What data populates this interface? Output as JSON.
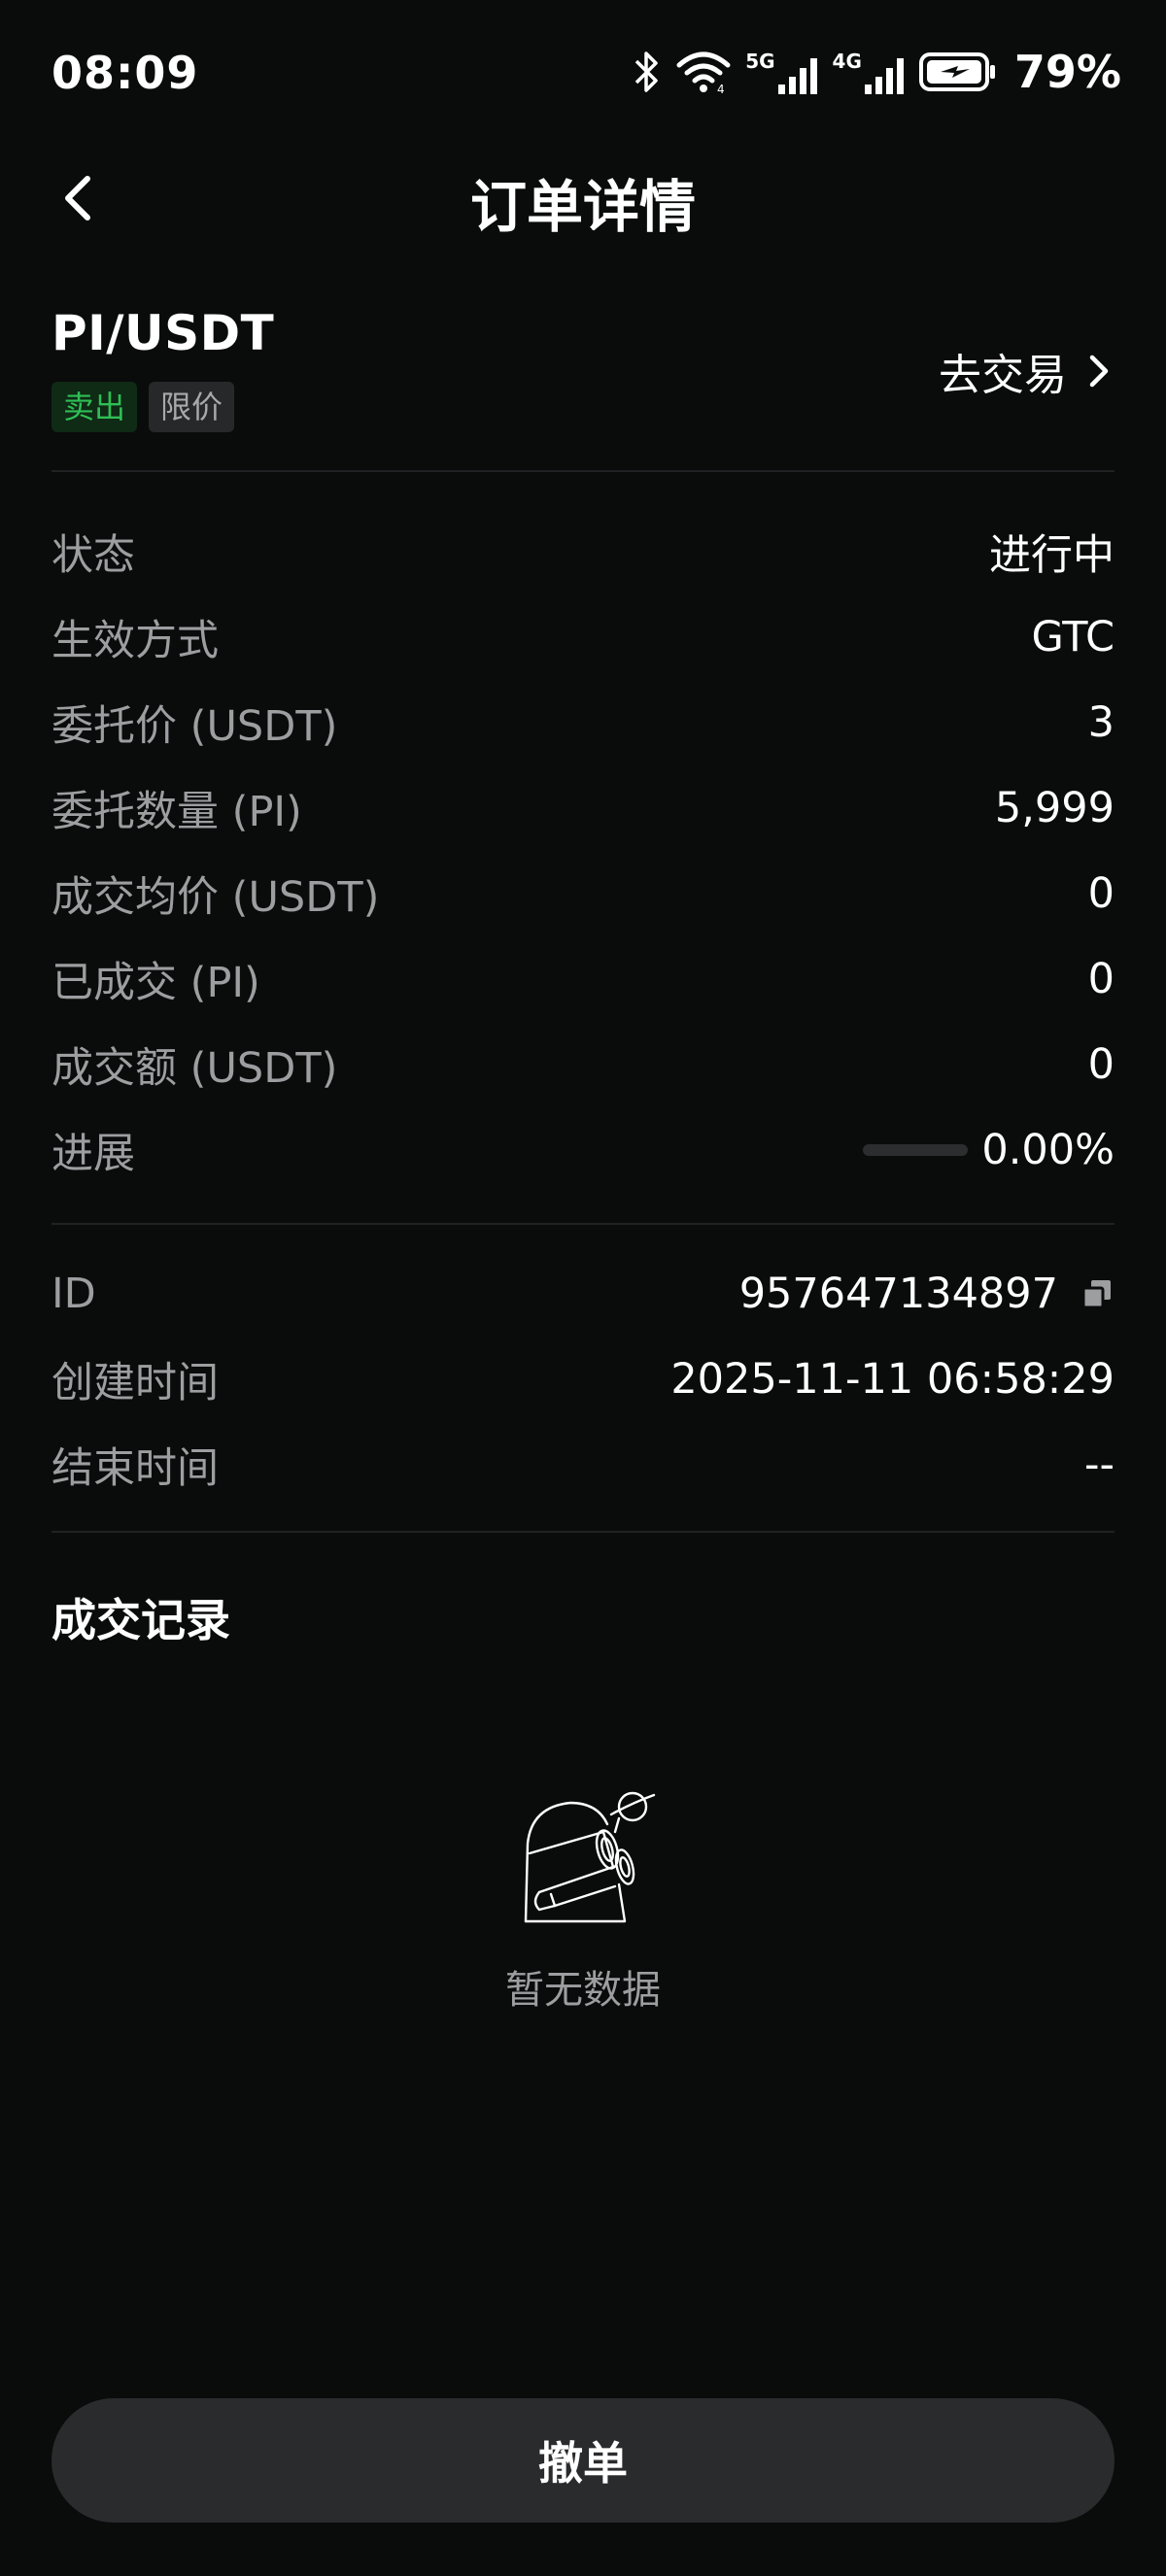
{
  "status_bar": {
    "time": "08:09",
    "battery": "79%",
    "icons": [
      "bluetooth-icon",
      "wifi-icon",
      "signal-5g-icon",
      "signal-4g-icon",
      "battery-charging-icon"
    ],
    "net1": "5G",
    "net2": "4G"
  },
  "header": {
    "title": "订单详情",
    "back_icon": "chevron-left-icon"
  },
  "pair": {
    "symbol": "PI/USDT",
    "side": "卖出",
    "order_type": "限价",
    "go_trade": "去交易",
    "side_color": "#2fbf55"
  },
  "details": [
    {
      "label": "状态",
      "value": "进行中"
    },
    {
      "label": "生效方式",
      "value": "GTC"
    },
    {
      "label": "委托价 (USDT)",
      "value": "3"
    },
    {
      "label": "委托数量 (PI)",
      "value": "5,999"
    },
    {
      "label": "成交均价 (USDT)",
      "value": "0"
    },
    {
      "label": "已成交 (PI)",
      "value": "0"
    },
    {
      "label": "成交额 (USDT)",
      "value": "0"
    },
    {
      "label": "进展",
      "value": "0.00%",
      "progress": 0
    }
  ],
  "meta": [
    {
      "label": "ID",
      "value": "957647134897",
      "icon": "copy-icon"
    },
    {
      "label": "创建时间",
      "value": "2025-11-11 06:58:29"
    },
    {
      "label": "结束时间",
      "value": "--"
    }
  ],
  "trades": {
    "title": "成交记录",
    "empty_text": "暂无数据",
    "empty_icon": "telescope-planet-icon"
  },
  "actions": {
    "cancel": "撤单"
  }
}
